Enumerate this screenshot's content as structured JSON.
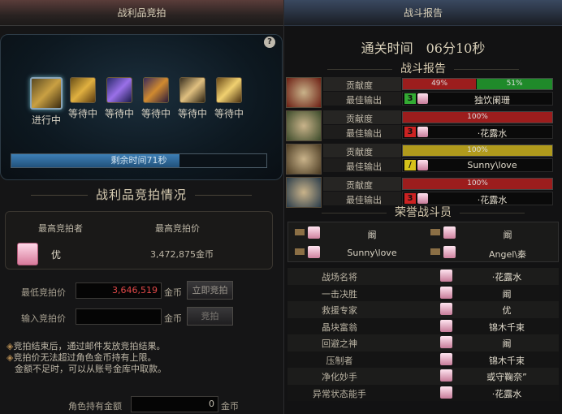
{
  "left": {
    "title": "战利品竞拍",
    "help": "?",
    "items": [
      {
        "label": "进行中",
        "icon": "loot-chest-icon",
        "active": true
      },
      {
        "label": "等待中",
        "icon": "gold-gear-icon"
      },
      {
        "label": "等待中",
        "icon": "purple-cube-icon"
      },
      {
        "label": "等待中",
        "icon": "armor-box-icon"
      },
      {
        "label": "等待中",
        "icon": "orb-icon"
      },
      {
        "label": "等待中",
        "icon": "scroll-icon"
      }
    ],
    "timer": {
      "label": "剩余时间71秒",
      "progress": 0.66
    },
    "section_title": "战利品竞拍情况",
    "table": {
      "col_bidder": "最高竞拍者",
      "col_price": "最高竞拍价",
      "bidder": "优",
      "price": "3,472,875金币"
    },
    "min_bid": {
      "label": "最低竞拍价",
      "value": "3,646,519",
      "unit": "金币",
      "button": "立即竞拍"
    },
    "input_bid": {
      "label": "输入竞拍价",
      "value": "",
      "unit": "金币",
      "button": "竞拍"
    },
    "notes": [
      "竞拍结束后，通过邮件发放竞拍结果。",
      "竞拍价无法超过角色金币持有上限。",
      "金额不足时，可以从账号金库中取款。"
    ],
    "own_gold": {
      "label": "角色持有金额",
      "value": "0",
      "unit": "金币"
    }
  },
  "right": {
    "title": "战斗报告",
    "clear_time": "通关时间　06分10秒",
    "report_title": "战斗报告",
    "contrib_label": "贡献度",
    "best_label": "最佳输出",
    "reports": [
      {
        "segments": [
          {
            "pct": "49%",
            "value": 49,
            "color": "#9c1d1d"
          },
          {
            "pct": "51%",
            "value": 51,
            "color": "#1f8a2a"
          }
        ],
        "rank": "3",
        "rank_color": "#33aa33",
        "name": "独饮阑珊",
        "face": "#6b1d12"
      },
      {
        "segments": [
          {
            "pct": "100%",
            "value": 100,
            "color": "#9c1d1d"
          }
        ],
        "rank": "3",
        "rank_color": "#cc2222",
        "name": "·花露水",
        "face": "#3b4a2a"
      },
      {
        "segments": [
          {
            "pct": "100%",
            "value": 100,
            "color": "#b09a1c"
          }
        ],
        "rank": "/",
        "rank_color": "#d6c21a",
        "name": "Sunny\\love",
        "face": "#4a3a22"
      },
      {
        "segments": [
          {
            "pct": "100%",
            "value": 100,
            "color": "#9c1d1d"
          }
        ],
        "rank": "3",
        "rank_color": "#cc2222",
        "name": "·花露水",
        "face": "#2a3c4a"
      }
    ],
    "honor_title": "荣誉战斗员",
    "honor": [
      "阚",
      "阚",
      "Sunny\\love",
      "Angel\\秦"
    ],
    "awards": [
      {
        "title": "战场名将",
        "name": "·花露水"
      },
      {
        "title": "一击决胜",
        "name": "阚"
      },
      {
        "title": "救援专家",
        "name": "优"
      },
      {
        "title": "晶块富翁",
        "name": "锦木千束"
      },
      {
        "title": "回避之神",
        "name": "阚"
      },
      {
        "title": "压制者",
        "name": "锦木千束"
      },
      {
        "title": "净化妙手",
        "name": "或守鞠奈”"
      },
      {
        "title": "异常状态能手",
        "name": "·花露水"
      }
    ]
  }
}
